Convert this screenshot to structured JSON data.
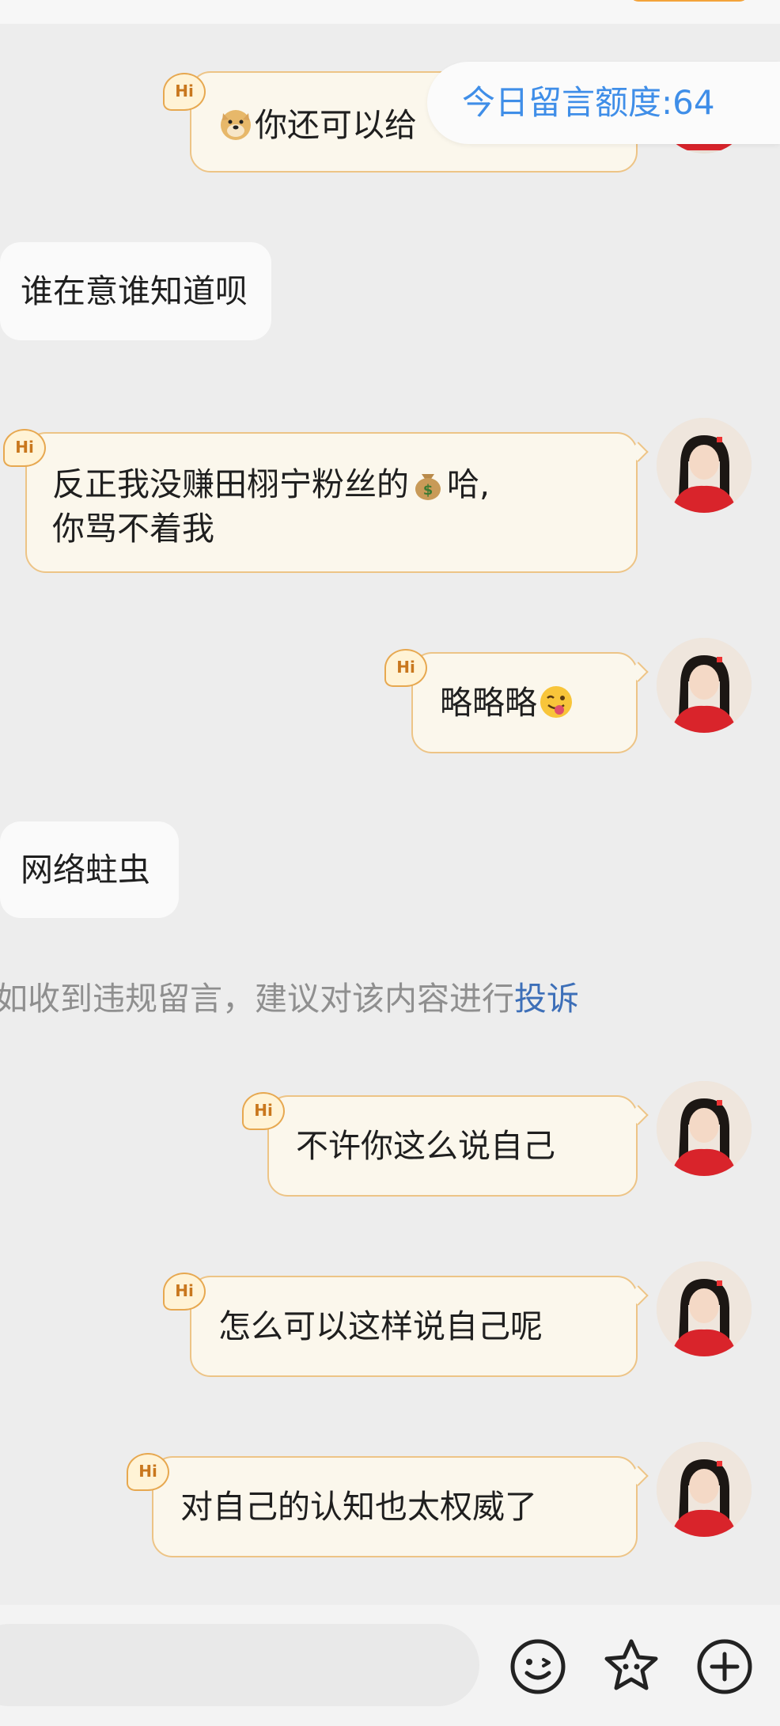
{
  "header": {
    "quota_text": "今日留言额度:64"
  },
  "messages": [
    {
      "side": "right",
      "text_before": "",
      "emoji": "doge",
      "text": "你还可以给",
      "badge": "Hi"
    },
    {
      "side": "left",
      "text": "谁在意谁知道呗"
    },
    {
      "side": "right",
      "line1": "反正我没赚田栩宁粉丝的",
      "emoji": "money-bag",
      "line1_after": "哈,",
      "line2": "你骂不着我",
      "badge": "Hi"
    },
    {
      "side": "right",
      "text": "略略略",
      "emoji": "winking-tongue",
      "badge": "Hi"
    },
    {
      "side": "left",
      "text": "网络蛀虫"
    },
    {
      "side": "right",
      "text": "不许你这么说自己",
      "badge": "Hi"
    },
    {
      "side": "right",
      "text": "怎么可以这样说自己呢",
      "badge": "Hi"
    },
    {
      "side": "right",
      "text": "对自己的认知也太权威了",
      "badge": "Hi"
    }
  ],
  "notice": {
    "text": "如收到违规留言，建议对该内容进行",
    "link": "投诉"
  },
  "input_bar": {
    "icons": [
      "smile-icon",
      "star-sticker-icon",
      "plus-icon"
    ]
  },
  "colors": {
    "accent_blue": "#3f8ee8",
    "bubble_border": "#edc486",
    "link_blue": "#3d6fb8"
  }
}
